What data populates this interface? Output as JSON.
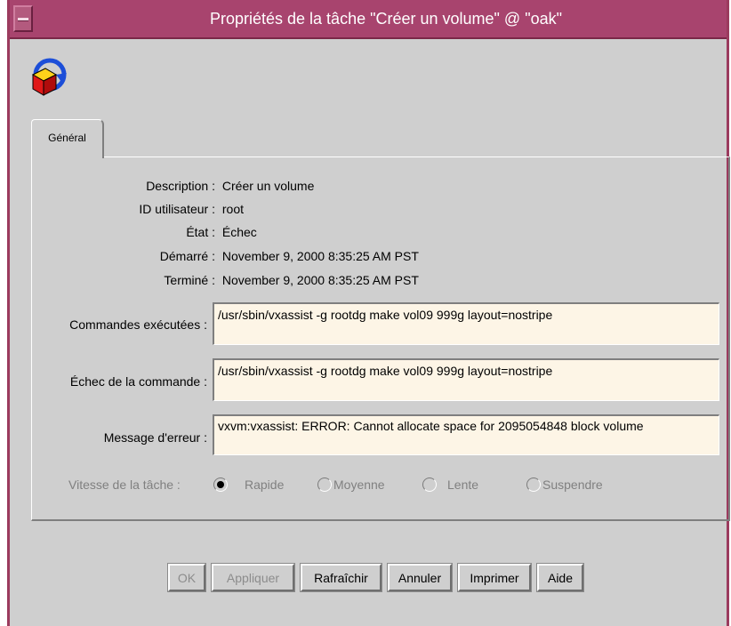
{
  "window": {
    "title": "Propriétés de la tâche \"Créer un volume\" @ \"oak\"",
    "app_icon": "volume-cube-refresh-icon"
  },
  "tabs": [
    {
      "label": "Général",
      "selected": true
    }
  ],
  "general": {
    "description": {
      "label": "Description :",
      "value": "Créer un volume"
    },
    "user_id": {
      "label": "ID utilisateur :",
      "value": "root"
    },
    "state": {
      "label": "État :",
      "value": "Échec"
    },
    "started": {
      "label": "Démarré :",
      "value": "November 9, 2000 8:35:25 AM PST"
    },
    "finished": {
      "label": "Terminé :",
      "value": "November 9, 2000 8:35:25 AM PST"
    },
    "commands_executed": {
      "label": "Commandes exécutées :",
      "value": "/usr/sbin/vxassist  -g rootdg   make vol09 999g layout=nostripe"
    },
    "failed_command": {
      "label": "Échec de la commande :",
      "value": "/usr/sbin/vxassist  -g rootdg   make vol09 999g layout=nostripe"
    },
    "error_message": {
      "label": "Message d'erreur :",
      "value": "vxvm:vxassist: ERROR: Cannot allocate space for 2095054848 block volume"
    },
    "task_speed": {
      "label": "Vitesse de la tâche :",
      "options": [
        "Rapide",
        "Moyenne",
        "Lente",
        "Suspendre"
      ],
      "selected": "Rapide",
      "enabled": false
    }
  },
  "buttons": {
    "ok": "OK",
    "apply": "Appliquer",
    "refresh": "Rafraîchir",
    "cancel": "Annuler",
    "print": "Imprimer",
    "help": "Aide"
  },
  "colors": {
    "titlebar": "#a8446e",
    "window_bg": "#cfcfcf",
    "textbox_bg": "#fdf5e6"
  }
}
